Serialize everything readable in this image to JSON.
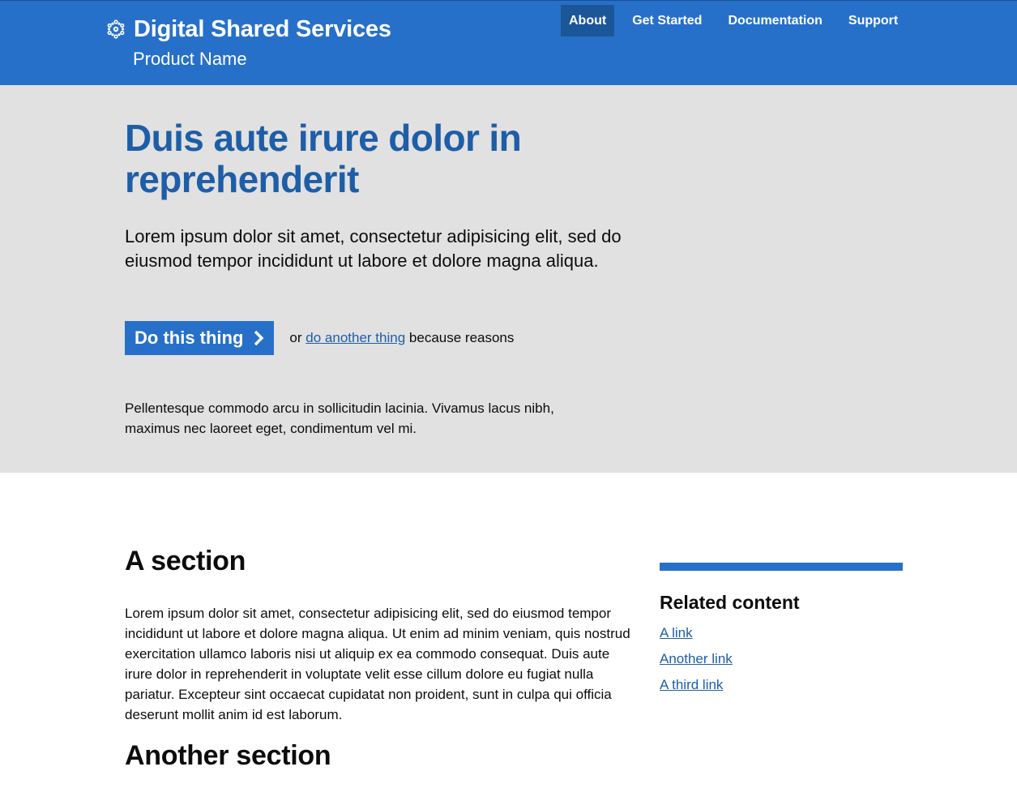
{
  "header": {
    "service_name": "Digital Shared Services",
    "product_name": "Product Name",
    "logo_icon": "snowflake-crest-icon",
    "nav": {
      "about": "About",
      "get_started": "Get Started",
      "documentation": "Documentation",
      "support": "Support",
      "active": "About"
    }
  },
  "hero": {
    "title": "Duis aute irure dolor in reprehenderit",
    "lede": "Lorem ipsum dolor sit amet, consectetur adipisicing elit, sed do eiusmod tempor incididunt ut labore et dolore magna aliqua.",
    "cta_label": "Do this thing",
    "cta_icon": "chevron-right-icon",
    "alt_prefix": "or",
    "alt_link": "do another thing",
    "alt_suffix": "because reasons",
    "note": "Pellentesque commodo arcu in sollicitudin lacinia. Vivamus lacus nibh, maximus nec laoreet eget, condimentum vel mi."
  },
  "main": {
    "section1_title": "A section",
    "section1_body": "Lorem ipsum dolor sit amet, consectetur adipisicing elit, sed do eiusmod tempor incididunt ut labore et dolore magna aliqua. Ut enim ad minim veniam, quis nostrud exercitation ullamco laboris nisi ut aliquip ex ea commodo consequat. Duis aute irure dolor in reprehenderit in voluptate velit esse cillum dolore eu fugiat nulla pariatur. Excepteur sint occaecat cupidatat non proident, sunt in culpa qui officia deserunt mollit anim id est laborum.",
    "section2_title": "Another section"
  },
  "related": {
    "title": "Related content",
    "links": [
      "A link",
      "Another link",
      "A third link"
    ]
  },
  "colors": {
    "brand_blue": "#2770c9",
    "nav_active": "#1b5699",
    "heading_blue": "#1e5ea8",
    "hero_background": "#e1e1e1"
  }
}
